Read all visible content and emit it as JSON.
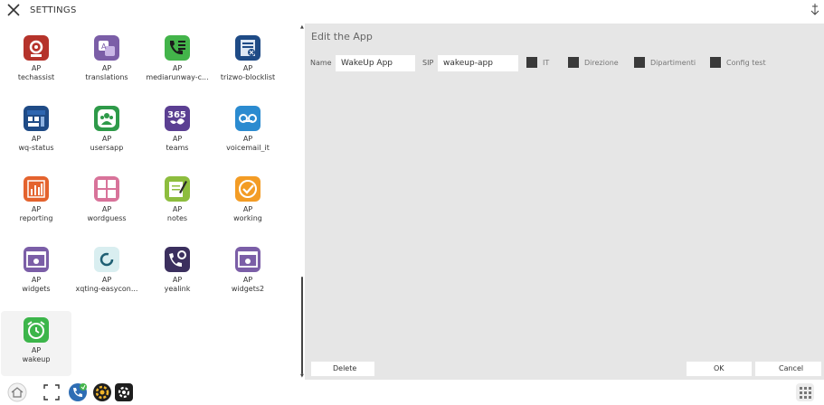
{
  "window": {
    "title": "SETTINGS"
  },
  "apps": [
    {
      "name": "techassist",
      "prefix": "AP",
      "label": "techassist",
      "icon": "support-icon",
      "color": "#b5332b"
    },
    {
      "name": "translations",
      "prefix": "AP",
      "label": "translations",
      "icon": "translate-icon",
      "color": "#7b5ea7"
    },
    {
      "name": "mediarunway",
      "prefix": "AP",
      "label": "mediarunway-c...",
      "icon": "phone-list-icon",
      "color": "#43b44a"
    },
    {
      "name": "trizwo-blocklist",
      "prefix": "AP",
      "label": "trizwo-blocklist",
      "icon": "blocklist-icon",
      "color": "#1f4b86"
    },
    {
      "name": "wq-status",
      "prefix": "AP",
      "label": "wq-status",
      "icon": "dashboard-icon",
      "color": "#1f4b86"
    },
    {
      "name": "usersapp",
      "prefix": "AP",
      "label": "usersapp",
      "icon": "users-icon",
      "color": "#2e9a49"
    },
    {
      "name": "teams",
      "prefix": "AP",
      "label": "teams",
      "icon": "365-icon",
      "color": "#5b3f92"
    },
    {
      "name": "voicemail_it",
      "prefix": "AP",
      "label": "voicemail_it",
      "icon": "voicemail-icon",
      "color": "#2b8bd0"
    },
    {
      "name": "reporting",
      "prefix": "AP",
      "label": "reporting",
      "icon": "bar-chart-icon",
      "color": "#e4632e"
    },
    {
      "name": "wordguess",
      "prefix": "AP",
      "label": "wordguess",
      "icon": "letter-blocks-icon",
      "color": "#d8739a"
    },
    {
      "name": "notes",
      "prefix": "AP",
      "label": "notes",
      "icon": "notes-icon",
      "color": "#8dbd3e"
    },
    {
      "name": "working",
      "prefix": "AP",
      "label": "working",
      "icon": "clock-check-icon",
      "color": "#f39c25"
    },
    {
      "name": "widgets",
      "prefix": "AP",
      "label": "widgets",
      "icon": "widget-window-icon",
      "color": "#7b5ea7"
    },
    {
      "name": "xqting-easycon",
      "prefix": "AP",
      "label": "xqting-easycon...",
      "icon": "refresh-icon",
      "color": "#d9eef0"
    },
    {
      "name": "yealink",
      "prefix": "AP",
      "label": "yealink",
      "icon": "phone-gear-icon",
      "color": "#3b2f5e"
    },
    {
      "name": "widgets2",
      "prefix": "AP",
      "label": "widgets2",
      "icon": "widget-window-icon",
      "color": "#7b5ea7"
    },
    {
      "name": "wakeup",
      "prefix": "AP",
      "label": "wakeup",
      "icon": "alarm-clock-icon",
      "color": "#3cb54a"
    }
  ],
  "editor": {
    "title": "Edit the App",
    "name_label": "Name",
    "name_value": "WakeUp App",
    "sip_label": "SIP",
    "sip_value": "wakeup-app",
    "checkboxes": [
      {
        "label": "IT"
      },
      {
        "label": "Direzione"
      },
      {
        "label": "Dipartimenti"
      },
      {
        "label": "Config test"
      }
    ],
    "delete_label": "Delete",
    "ok_label": "OK",
    "cancel_label": "Cancel"
  },
  "taskbar": {
    "icons": [
      "home-icon",
      "fullscreen-icon",
      "phone-status-icon",
      "app-gear-icon",
      "settings-gear-icon",
      "grid-menu-icon"
    ]
  }
}
